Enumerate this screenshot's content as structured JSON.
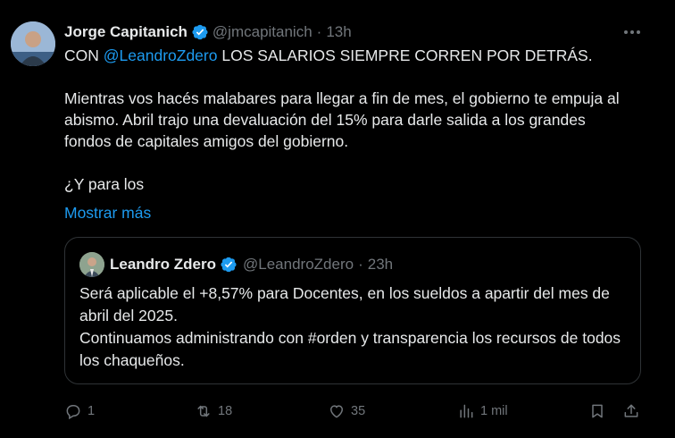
{
  "author": {
    "name": "Jorge Capitanich",
    "handle": "@jmcapitanich",
    "time": "13h"
  },
  "body": {
    "line1_prefix": "CON",
    "mention": "@LeandroZdero",
    "line1_suffix": "LOS SALARIOS SIEMPRE CORREN POR DETRÁS.",
    "paragraph2": "Mientras vos hacés malabares para llegar a fin de mes, el gobierno te empuja al abismo. Abril trajo una devaluación del 15% para darle salida a los grandes fondos de capitales amigos del gobierno.",
    "paragraph3": "¿Y para los",
    "show_more": "Mostrar más"
  },
  "quote": {
    "name": "Leandro Zdero",
    "handle": "@LeandroZdero",
    "time": "23h",
    "line1": "Será aplicable el +8,57% para Docentes, en los sueldos a apartir del mes de abril del 2025.",
    "line2": "Continuamos administrando con #orden y transparencia los recursos de todos los chaqueños."
  },
  "actions": {
    "replies": "1",
    "retweets": "18",
    "likes": "35",
    "views": "1 mil"
  },
  "colors": {
    "background": "#000000",
    "text": "#e7e9ea",
    "muted": "#71767b",
    "accent": "#1d9bf0",
    "border": "#2f3336"
  },
  "icons": {
    "verified": "verified-badge-icon",
    "more": "more-horizontal-icon",
    "reply": "reply-icon",
    "retweet": "retweet-icon",
    "like": "heart-icon",
    "views": "views-chart-icon",
    "bookmark": "bookmark-icon",
    "share": "share-icon"
  }
}
